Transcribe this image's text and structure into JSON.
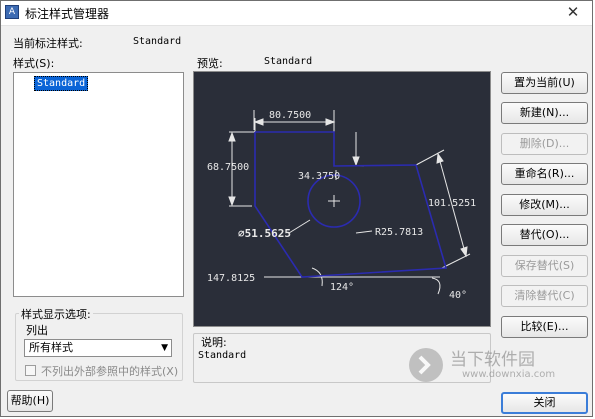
{
  "window": {
    "title": "标注样式管理器",
    "close_glyph": "✕"
  },
  "current_style": {
    "label": "当前标注样式:",
    "value": "Standard"
  },
  "styles": {
    "label": "样式(S):",
    "items": [
      "Standard"
    ]
  },
  "preview": {
    "label": "预览:",
    "value": "Standard",
    "dims": {
      "top_width": "80.7500",
      "left_height": "68.7500",
      "small_vertical": "34.3750",
      "slant": "101.5251",
      "diameter": "⌀51.5625",
      "radius": "R25.7813",
      "bottom": "147.8125",
      "angle_bottom": "124°",
      "angle_right": "40°"
    }
  },
  "display_options": {
    "group_label": "样式显示选项:",
    "list_label": "列出",
    "list_value": "所有样式",
    "exclude_xref_label": "不列出外部参照中的样式(X)"
  },
  "description": {
    "label": "说明:",
    "value": "Standard"
  },
  "buttons": {
    "set_current": "置为当前(U)",
    "new": "新建(N)...",
    "delete": "删除(D)...",
    "rename": "重命名(R)...",
    "modify": "修改(M)...",
    "override": "替代(O)...",
    "save_override": "保存替代(S)",
    "clear_override": "清除替代(C)",
    "compare": "比较(E)...",
    "help": "帮助(H)",
    "close": "关闭"
  },
  "watermark": {
    "brand": "当下软件园",
    "url": "www.downxia.com"
  },
  "colors": {
    "preview_bg": "#2a2e39",
    "outline": "#2b2bb0",
    "dim_text": "#e8e8e8",
    "selection": "#0a64d7"
  }
}
